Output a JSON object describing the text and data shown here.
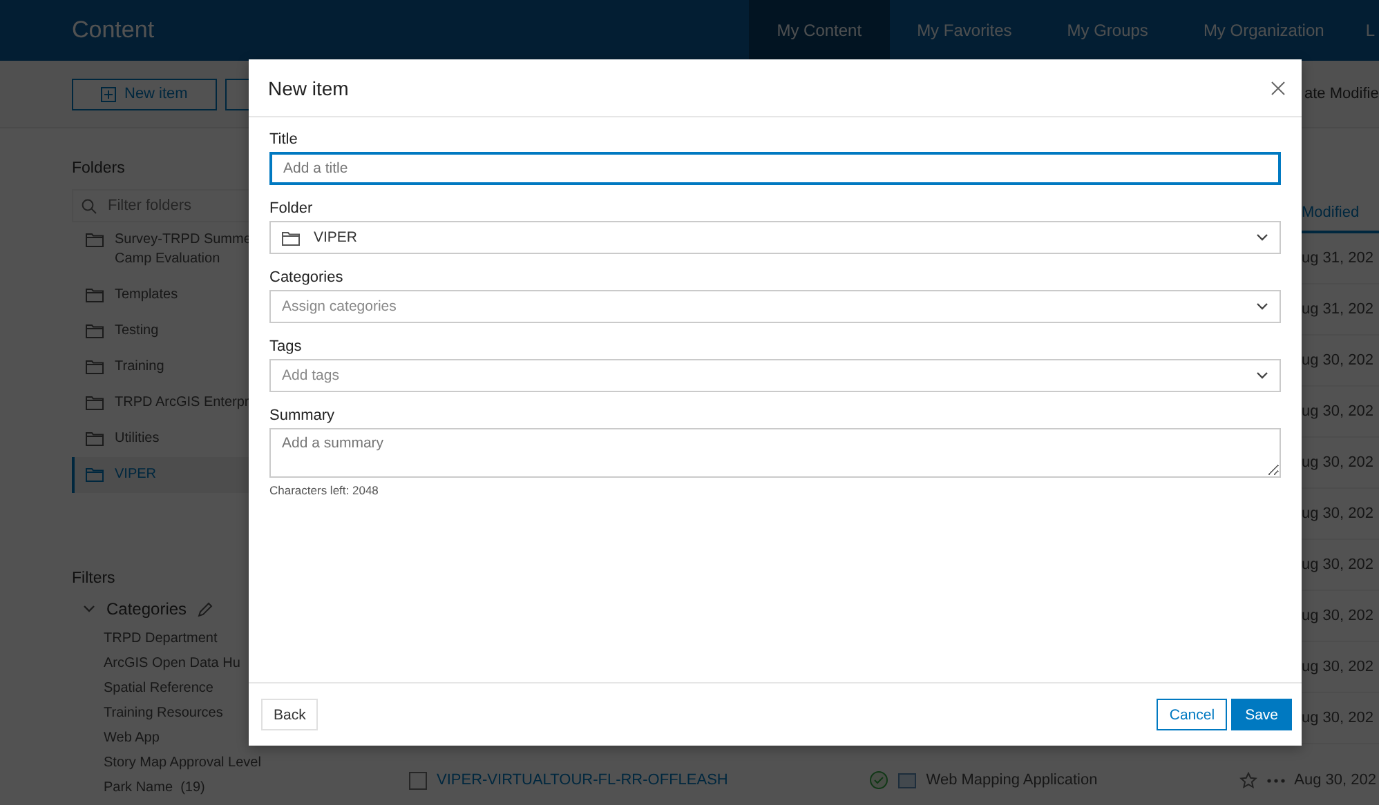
{
  "header": {
    "title": "Content",
    "nav": [
      {
        "label": "My Content",
        "selected": true
      },
      {
        "label": "My Favorites",
        "selected": false
      },
      {
        "label": "My Groups",
        "selected": false
      },
      {
        "label": "My Organization",
        "selected": false
      },
      {
        "label": "L",
        "selected": false
      }
    ]
  },
  "toolbar": {
    "new_button": "New item",
    "sort_label": "ate Modifie"
  },
  "sidebar": {
    "folders_heading": "Folders",
    "filter": {
      "placeholder": "Filter folders"
    },
    "folders": [
      {
        "label": "Survey-TRPD Summe\nCamp Evaluation",
        "selected": false
      },
      {
        "label": "Templates",
        "selected": false
      },
      {
        "label": "Testing",
        "selected": false
      },
      {
        "label": "Training",
        "selected": false
      },
      {
        "label": "TRPD ArcGIS Enterpr",
        "selected": false
      },
      {
        "label": "Utilities",
        "selected": false
      },
      {
        "label": "VIPER",
        "selected": true
      }
    ],
    "filters_heading": "Filters",
    "categories": {
      "label": "Categories",
      "expanded": true,
      "items": [
        {
          "label": "TRPD Department"
        },
        {
          "label": "ArcGIS Open Data Hu"
        },
        {
          "label": "Spatial Reference"
        },
        {
          "label": "Training Resources"
        },
        {
          "label": "Web App"
        },
        {
          "label": "Story Map Approval Level"
        },
        {
          "label": "Park Name",
          "count": "(19)"
        }
      ]
    }
  },
  "table": {
    "column_header": "Modified",
    "rows": [
      {
        "modified": "ug 31, 202"
      },
      {
        "modified": "ug 31, 202"
      },
      {
        "modified": "ug 30, 202"
      },
      {
        "modified": "ug 30, 202"
      },
      {
        "modified": "ug 30, 202"
      },
      {
        "modified": "ug 30, 202"
      },
      {
        "modified": "ug 30, 202"
      },
      {
        "modified": "ug 30, 202"
      },
      {
        "modified": "ug 30, 202"
      },
      {
        "modified": "ug 30, 202"
      }
    ],
    "full_rows": [
      {
        "title": "VIPER-VIRTUALTOUR-FL-RR-OFFLEASH",
        "type": "Web Mapping Application",
        "modified": "Aug 30, 202",
        "favorite": false,
        "selected": false
      }
    ]
  },
  "dialog": {
    "title": "New item",
    "fields": [
      {
        "kind": "text",
        "label": "Title",
        "placeholder": "Add a title",
        "focused": true
      },
      {
        "kind": "folder-select",
        "label": "Folder",
        "value": "VIPER",
        "focused": false
      },
      {
        "kind": "select",
        "label": "Categories",
        "placeholder": "Assign categories",
        "focused": false
      },
      {
        "kind": "select",
        "label": "Tags",
        "placeholder": "Add tags",
        "focused": false
      },
      {
        "kind": "textarea",
        "label": "Summary",
        "placeholder": "Add a summary",
        "hint": "Characters left: 2048",
        "focused": false
      }
    ],
    "buttons": {
      "back": "Back",
      "cancel": "Cancel",
      "save": "Save"
    }
  }
}
